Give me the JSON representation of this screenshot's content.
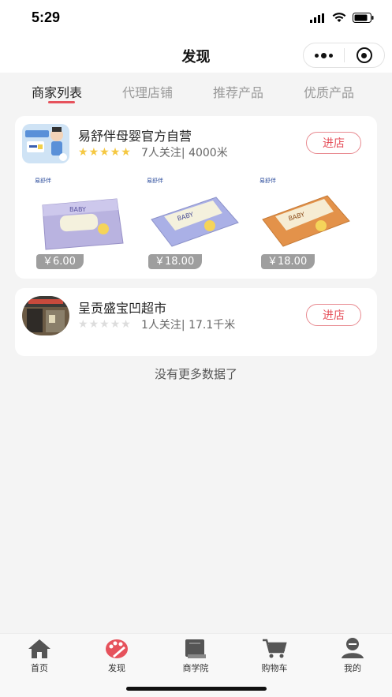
{
  "status": {
    "time": "5:29"
  },
  "nav": {
    "title": "发现"
  },
  "tabs": [
    {
      "label": "商家列表",
      "active": true
    },
    {
      "label": "代理店铺",
      "active": false
    },
    {
      "label": "推荐产品",
      "active": false
    },
    {
      "label": "优质产品",
      "active": false
    }
  ],
  "shops": [
    {
      "name": "易舒伴母婴官方自营",
      "rating": 5,
      "meta": "7人关注| 4000米",
      "enter_label": "进店",
      "products": [
        {
          "brand": "易舒伴",
          "price": "￥6.00",
          "pack_color": "#b9b3e0"
        },
        {
          "brand": "易舒伴",
          "price": "￥18.00",
          "pack_color": "#aab0e6"
        },
        {
          "brand": "易舒伴",
          "price": "￥18.00",
          "pack_color": "#e3924a"
        }
      ]
    },
    {
      "name": "呈贡盛宝凹超市",
      "rating": 0,
      "meta": "1人关注| 17.1千米",
      "enter_label": "进店",
      "products": []
    }
  ],
  "footer_text": "没有更多数据了",
  "tabbar": [
    {
      "label": "首页",
      "icon": "home-icon",
      "active": false
    },
    {
      "label": "发现",
      "icon": "discover-icon",
      "active": true
    },
    {
      "label": "商学院",
      "icon": "book-icon",
      "active": false
    },
    {
      "label": "购物车",
      "icon": "cart-icon",
      "active": false
    },
    {
      "label": "我的",
      "icon": "profile-icon",
      "active": false
    }
  ],
  "colors": {
    "accent": "#e6525c",
    "star_on": "#f5c842",
    "star_off": "#dddddd",
    "background": "#f4f4f4"
  }
}
